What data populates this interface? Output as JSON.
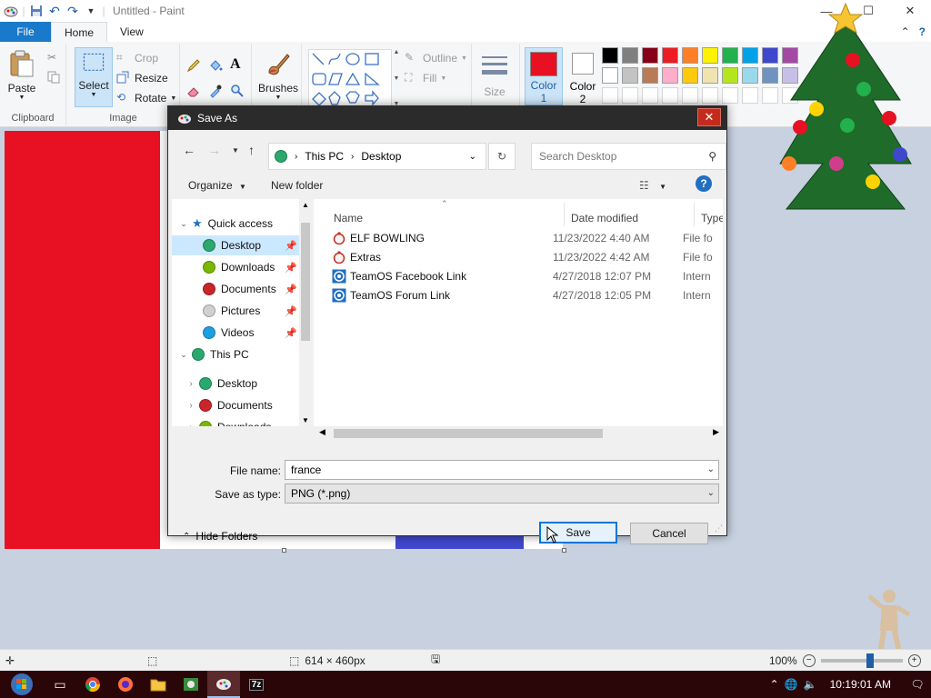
{
  "app": {
    "title": "Untitled - Paint",
    "window_controls": [
      "minimize-icon",
      "maximize-icon",
      "close-icon"
    ]
  },
  "ribbon": {
    "tabs": [
      "File",
      "Home",
      "View"
    ],
    "clipboard": {
      "paste": "Paste",
      "label": "Clipboard"
    },
    "image": {
      "select": "Select",
      "crop": "Crop",
      "resize": "Resize",
      "rotate": "Rotate",
      "label": "Image"
    },
    "tools": {
      "brushes": "Brushes"
    },
    "shapes": {
      "outline": "Outline",
      "fill": "Fill"
    },
    "size": "Size",
    "color1": {
      "label": "Color",
      "num": "1",
      "value": "#e81123"
    },
    "color2": {
      "label": "Color",
      "num": "2",
      "value": "#ffffff"
    },
    "palette_row1": [
      "#000000",
      "#7f7f7f",
      "#880015",
      "#ed1c24",
      "#ff7f27",
      "#fff200",
      "#22b14c",
      "#00a2e8",
      "#3f48cc",
      "#a349a4"
    ],
    "palette_row2": [
      "#ffffff",
      "#c3c3c3",
      "#b97a57",
      "#ffaec9",
      "#ffc90e",
      "#efe4b0",
      "#b5e61d",
      "#99d9ea",
      "#7092be",
      "#c8bfe7"
    ]
  },
  "canvas": {
    "stripes": [
      {
        "color": "#e81123",
        "from": 0.0,
        "to": 0.278
      },
      {
        "color": "#ffffff",
        "from": 0.278,
        "to": 0.7
      },
      {
        "color": "#3f48cc",
        "from": 0.7,
        "to": 0.93
      }
    ]
  },
  "dialog": {
    "title": "Save As",
    "address": {
      "segments": [
        "This PC",
        "Desktop"
      ]
    },
    "search_placeholder": "Search Desktop",
    "toolbar": {
      "organize": "Organize",
      "new_folder": "New folder"
    },
    "nav": [
      {
        "label": "Quick access",
        "kind": "header",
        "icon": "star-icon"
      },
      {
        "label": "Desktop",
        "kind": "pinned",
        "selected": true,
        "icon": "desktop-folder-icon",
        "color": "#2aa86e"
      },
      {
        "label": "Downloads",
        "kind": "pinned",
        "icon": "downloads-folder-icon",
        "color": "#7ab800"
      },
      {
        "label": "Documents",
        "kind": "pinned",
        "icon": "documents-folder-icon",
        "color": "#c8262b"
      },
      {
        "label": "Pictures",
        "kind": "pinned",
        "icon": "pictures-folder-icon",
        "color": "#d0d0d0"
      },
      {
        "label": "Videos",
        "kind": "pinned",
        "icon": "videos-folder-icon",
        "color": "#1ea0e0"
      },
      {
        "label": "This PC",
        "kind": "header",
        "icon": "pc-icon",
        "color": "#2aa86e"
      },
      {
        "label": "Desktop",
        "kind": "child",
        "icon": "desktop-folder-icon",
        "color": "#2aa86e"
      },
      {
        "label": "Documents",
        "kind": "child",
        "icon": "documents-folder-icon",
        "color": "#c8262b"
      },
      {
        "label": "Downloads",
        "kind": "child",
        "icon": "downloads-folder-icon",
        "color": "#7ab800"
      }
    ],
    "columns": [
      "Name",
      "Date modified",
      "Type"
    ],
    "files": [
      {
        "name": "ELF BOWLING",
        "date": "11/23/2022 4:40 AM",
        "type": "File fo",
        "icon": "folder-ornament-icon"
      },
      {
        "name": "Extras",
        "date": "11/23/2022 4:42 AM",
        "type": "File fo",
        "icon": "folder-ornament-icon"
      },
      {
        "name": "TeamOS Facebook Link",
        "date": "4/27/2018 12:07 PM",
        "type": "Intern",
        "icon": "internet-shortcut-icon"
      },
      {
        "name": "TeamOS Forum Link",
        "date": "4/27/2018 12:05 PM",
        "type": "Intern",
        "icon": "internet-shortcut-icon"
      }
    ],
    "file_name_label": "File name:",
    "file_name_value": "france",
    "save_as_type_label": "Save as type:",
    "save_as_type_value": "PNG (*.png)",
    "hide_folders": "Hide Folders",
    "save": "Save",
    "cancel": "Cancel"
  },
  "status": {
    "size": "614 × 460px",
    "zoom": "100%"
  },
  "taskbar": {
    "time": "10:19:01 AM"
  }
}
